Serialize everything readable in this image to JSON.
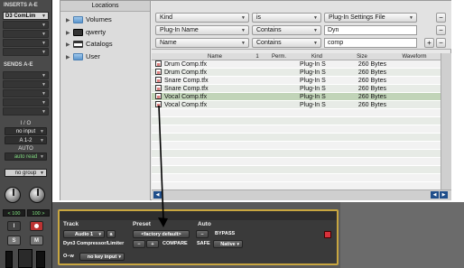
{
  "mixer": {
    "inserts_header": "INSERTS A-E",
    "insert_slot_1": "D3 ComLim",
    "sends_header": "SENDS A-E",
    "io_header": "I / O",
    "input": "no input",
    "output": "A 1-2",
    "auto_header": "AUTO",
    "auto_mode": "auto read",
    "group": "no group",
    "vol_left": "< 100",
    "vol_right": "100 >",
    "solo_label": "S",
    "mute_label": "M"
  },
  "locations": {
    "header": "Locations",
    "items": [
      {
        "label": "Volumes",
        "icon": "folder-icon"
      },
      {
        "label": "qwerty",
        "icon": "home-icon"
      },
      {
        "label": "Catalogs",
        "icon": "catalog-icon"
      },
      {
        "label": "User",
        "icon": "folder-icon"
      }
    ]
  },
  "search": {
    "row1": {
      "field": "Kind",
      "op": "is",
      "value": "Plug-In Settings File"
    },
    "row2": {
      "field": "Plug-In Name",
      "op": "Contains",
      "value": "Dyn"
    },
    "row3": {
      "field": "Name",
      "op": "Contains",
      "value": "comp"
    },
    "minus_label": "−",
    "plus_label": "+"
  },
  "table": {
    "columns": [
      "Name",
      "1",
      "Perm.",
      "Kind",
      "Size",
      "Waveform"
    ],
    "rows": [
      {
        "name": "Drum Comp.tfx",
        "kind": "Plug-In S",
        "size": "260 Bytes"
      },
      {
        "name": "Drum Comp.tfx",
        "kind": "Plug-In S",
        "size": "260 Bytes"
      },
      {
        "name": "Snare Comp.tfx",
        "kind": "Plug-In S",
        "size": "260 Bytes"
      },
      {
        "name": "Snare Comp.tfx",
        "kind": "Plug-In S",
        "size": "260 Bytes"
      },
      {
        "name": "Vocal Comp.tfx",
        "kind": "Plug-In S",
        "size": "260 Bytes",
        "selected": true
      },
      {
        "name": "Vocal Comp.tfx",
        "kind": "Plug-In S",
        "size": "260 Bytes"
      }
    ]
  },
  "plugin": {
    "track_header": "Track",
    "preset_header": "Preset",
    "auto_header": "Auto",
    "track_name": "Audio 1",
    "track_btn": "a",
    "preset_name": "<factory default>",
    "bypass": "BYPASS",
    "plugin_name": "Dyn3 Compressor/Limiter",
    "compare": "COMPARE",
    "safe": "SAFE",
    "native": "Native",
    "key_input": "no key input",
    "key_icon": "O−w"
  },
  "colors": {
    "plugin_border": "#c8a640",
    "selection": "#c1d4b8",
    "scroll_accent": "#1f4e8a"
  }
}
